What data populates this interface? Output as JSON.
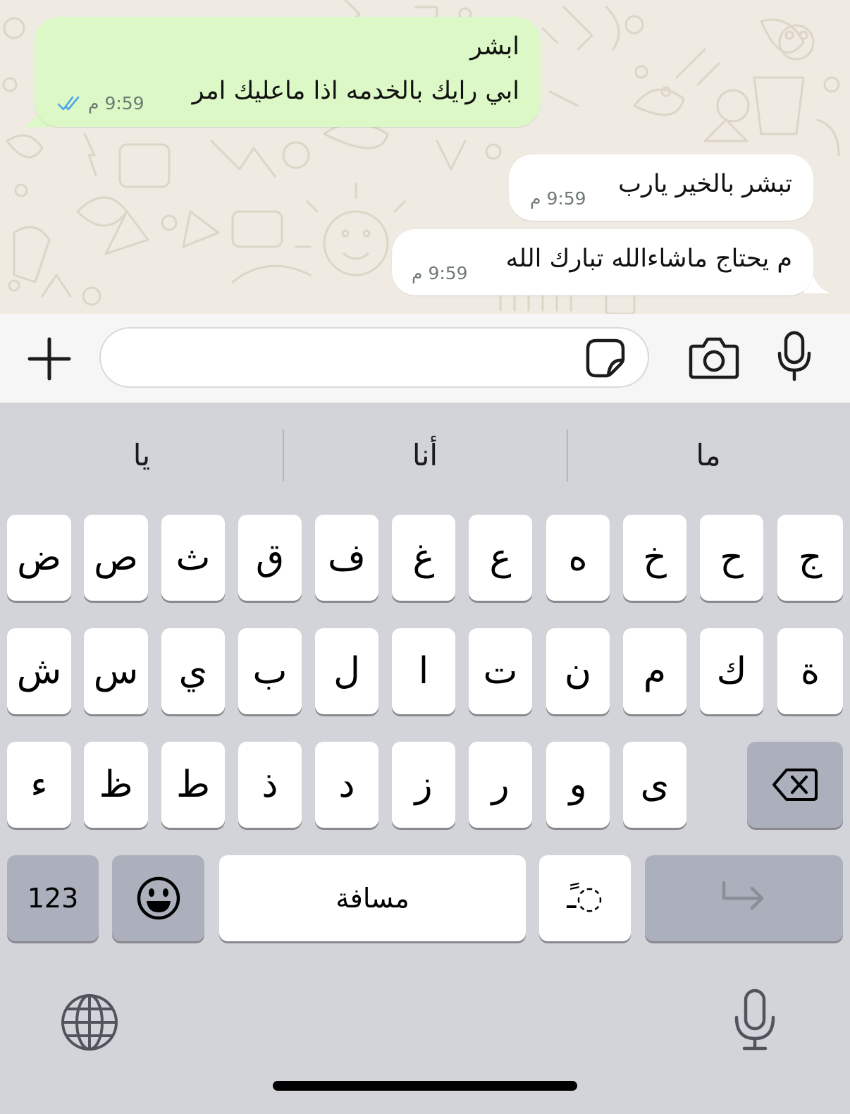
{
  "chat": {
    "messages": [
      {
        "direction": "outgoing",
        "lines": [
          "ابشر",
          "ابي رايك بالخدمه اذا ماعليك امر"
        ],
        "time": "9:59 م",
        "status": "read-double-check-icon"
      },
      {
        "direction": "incoming",
        "lines": [
          "تبشر بالخير يارب"
        ],
        "time": "9:59 م"
      },
      {
        "direction": "incoming",
        "lines": [
          "م يحتاج ماشاءالله تبارك الله"
        ],
        "time": "9:59 م"
      }
    ]
  },
  "input_bar": {
    "placeholder": "",
    "icons": [
      "plus-icon",
      "sticker-icon",
      "camera-icon",
      "microphone-icon"
    ]
  },
  "keyboard": {
    "suggestions": [
      "يا",
      "أنا",
      "ما"
    ],
    "row1": [
      "ض",
      "ص",
      "ث",
      "ق",
      "ف",
      "غ",
      "ع",
      "ه",
      "خ",
      "ح",
      "ج"
    ],
    "row2": [
      "ش",
      "س",
      "ي",
      "ب",
      "ل",
      "ا",
      "ت",
      "ن",
      "م",
      "ك",
      "ة"
    ],
    "row3": [
      "ء",
      "ظ",
      "ط",
      "ذ",
      "د",
      "ز",
      "ر",
      "و",
      "ى"
    ],
    "numbers_label": "123",
    "space_label": "مسافة",
    "diacritic_label": "ًـ◌",
    "icons": [
      "delete-icon",
      "emoji-icon",
      "return-icon",
      "globe-icon",
      "dictation-mic-icon"
    ]
  },
  "colors": {
    "chat_background": "#efeae2",
    "outgoing_bubble": "#dcf8c6",
    "incoming_bubble": "#ffffff",
    "keyboard_background": "#d2d4da",
    "special_key": "#abb0bc",
    "read_receipt": "#4fa6e8"
  }
}
